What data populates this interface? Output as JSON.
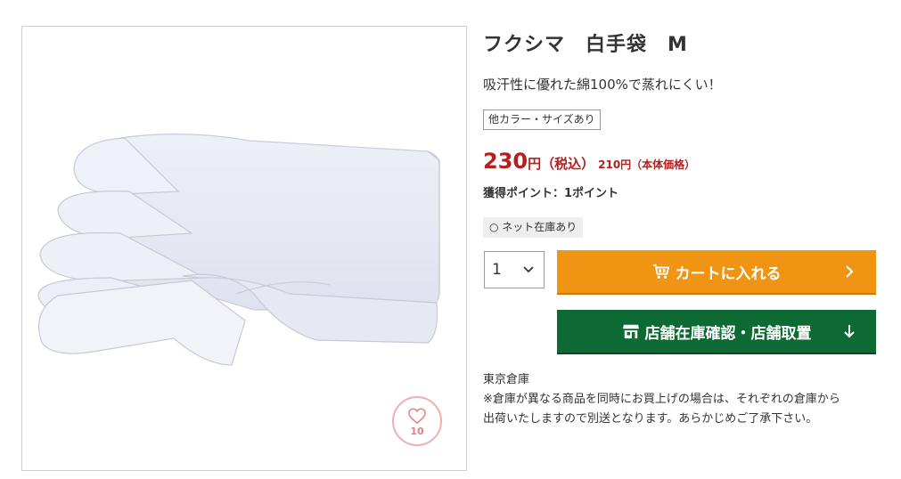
{
  "product": {
    "title": "フクシマ　白手袋　M",
    "catch_copy": "吸汗性に優れた綿100%で蒸れにくい！",
    "variant_tag": "他カラー・サイズあり",
    "price": {
      "amount": "230",
      "unit_tax": "円（税込）",
      "base": "210円（本体価格）"
    },
    "points": "獲得ポイント：1ポイント",
    "stock": "○ ネット在庫あり",
    "favorite_count": "10",
    "image_alt_icon": "white-glove-image"
  },
  "quantity": {
    "selected": "1",
    "icon": "chevron-down-icon"
  },
  "buttons": {
    "cart_label": "カートに入れる",
    "cart_icon": "cart-icon",
    "store_label": "店舗在庫確認・店舗取置",
    "store_icon": "store-icon"
  },
  "warehouse": {
    "name": "東京倉庫",
    "note_line1": "※倉庫が異なる商品を同時にお買上げの場合は、それぞれの倉庫から",
    "note_line2": "出荷いたしますので別送となります。あらかじめご了承下さい。"
  },
  "colors": {
    "price_red": "#b3201f",
    "cart_orange": "#ef9513",
    "store_green": "#0d6a33",
    "favorite_pink": "#e57d82"
  }
}
